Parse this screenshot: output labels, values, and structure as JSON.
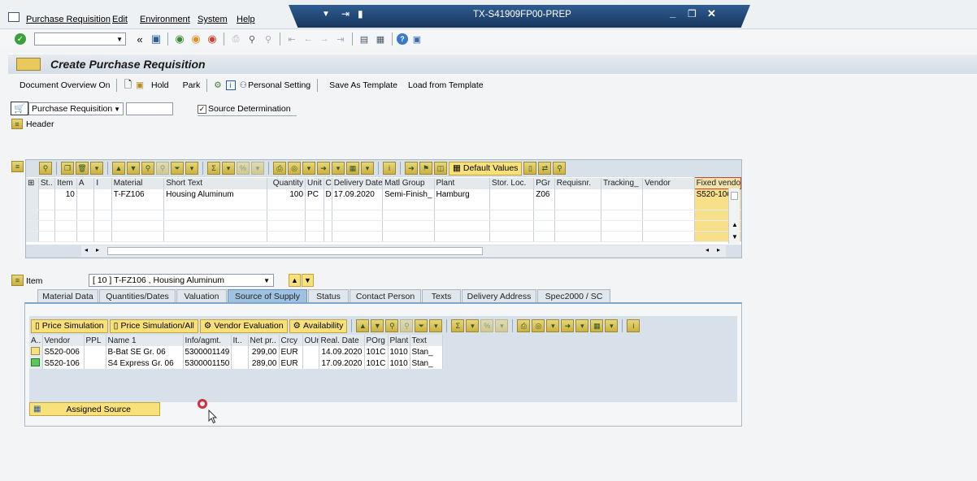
{
  "menu": {
    "items": [
      "Purchase Requisition",
      "Edit",
      "Environment",
      "System",
      "Help"
    ]
  },
  "window": {
    "title": "TX-S41909FP00-PREP"
  },
  "toolbar": {
    "command_value": ""
  },
  "page": {
    "title": "Create Purchase Requisition"
  },
  "app_toolbar": {
    "doc_overview": "Document Overview On",
    "hold": "Hold",
    "park": "Park",
    "personal_setting": "Personal Setting",
    "save_as_template": "Save As Template",
    "load_from_template": "Load from Template"
  },
  "header": {
    "doc_type": "Purchase Requisition",
    "doc_field": "",
    "source_determination": "Source Determination",
    "source_determination_checked": true,
    "header_label": "Header"
  },
  "items_grid": {
    "default_values": "Default Values",
    "columns": [
      "St..",
      "Item",
      "A",
      "I",
      "Material",
      "Short Text",
      "Quantity",
      "Unit",
      "C",
      "Delivery Date",
      "Matl Group",
      "Plant",
      "Stor. Loc.",
      "PGr",
      "Requisnr.",
      "Tracking_",
      "Vendor",
      "Fixed vendo"
    ],
    "rows": [
      [
        "",
        "10",
        "",
        "",
        "T-FZ106",
        "Housing Aluminum",
        "100",
        "PC",
        "D",
        "17.09.2020",
        "Semi-Finish_",
        "Hamburg",
        "",
        "Z06",
        "",
        "",
        "",
        "S520-106"
      ]
    ]
  },
  "item_detail": {
    "label": "Item",
    "selected": "[ 10 ] T-FZ106 , Housing Aluminum",
    "tabs": [
      "Material Data",
      "Quantities/Dates",
      "Valuation",
      "Source of Supply",
      "Status",
      "Contact Person",
      "Texts",
      "Delivery Address",
      "Spec2000 / SC"
    ],
    "active_tab": "Source of Supply"
  },
  "supply": {
    "buttons": {
      "price_sim": "Price Simulation",
      "price_sim_all": "Price Simulation/All",
      "vendor_eval": "Vendor Evaluation",
      "availability": "Availability"
    },
    "columns": [
      "A..",
      "Vendor",
      "PPL",
      "Name 1",
      "Info/agmt.",
      "It..",
      "Net pr..",
      "Crcy",
      "OUn",
      "Real. Date",
      "POrg",
      "Plant",
      "Text"
    ],
    "rows": [
      [
        "",
        "S520-006",
        "",
        "B-Bat SE Gr. 06",
        "5300001149",
        "",
        "299,00",
        "EUR",
        "",
        "14.09.2020",
        "101C",
        "1010",
        "Stan_"
      ],
      [
        "",
        "S520-106",
        "",
        "S4 Express Gr. 06",
        "5300001150",
        "",
        "289,00",
        "EUR",
        "",
        "17.09.2020",
        "101C",
        "1010",
        "Stan_"
      ]
    ],
    "assigned_source": "Assigned Source"
  }
}
